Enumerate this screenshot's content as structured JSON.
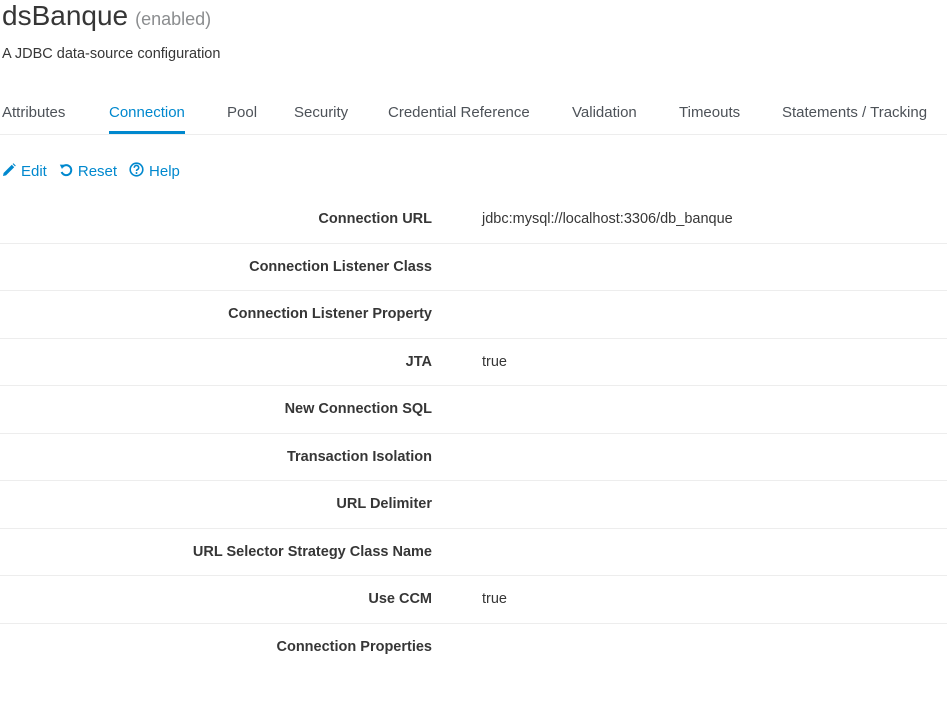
{
  "header": {
    "name": "dsBanque",
    "status": "(enabled)",
    "description": "A JDBC data-source configuration"
  },
  "tabs": [
    {
      "label": "Attributes",
      "active": false
    },
    {
      "label": "Connection",
      "active": true
    },
    {
      "label": "Pool",
      "active": false
    },
    {
      "label": "Security",
      "active": false
    },
    {
      "label": "Credential Reference",
      "active": false
    },
    {
      "label": "Validation",
      "active": false
    },
    {
      "label": "Timeouts",
      "active": false
    },
    {
      "label": "Statements / Tracking",
      "active": false
    }
  ],
  "toolbar": {
    "edit_label": "Edit",
    "reset_label": "Reset",
    "help_label": "Help",
    "edit_icon": "pencil-icon",
    "reset_icon": "undo-icon",
    "help_icon": "question-circle-icon"
  },
  "attributes": [
    {
      "label": "Connection URL",
      "value": "jdbc:mysql://localhost:3306/db_banque"
    },
    {
      "label": "Connection Listener Class",
      "value": ""
    },
    {
      "label": "Connection Listener Property",
      "value": ""
    },
    {
      "label": "JTA",
      "value": "true"
    },
    {
      "label": "New Connection SQL",
      "value": ""
    },
    {
      "label": "Transaction Isolation",
      "value": ""
    },
    {
      "label": "URL Delimiter",
      "value": ""
    },
    {
      "label": "URL Selector Strategy Class Name",
      "value": ""
    },
    {
      "label": "Use CCM",
      "value": "true"
    },
    {
      "label": "Connection Properties",
      "value": ""
    }
  ],
  "colors": {
    "accent": "#0088ce",
    "text": "#363636",
    "muted": "#8b8d8f",
    "divider": "#ededed"
  }
}
